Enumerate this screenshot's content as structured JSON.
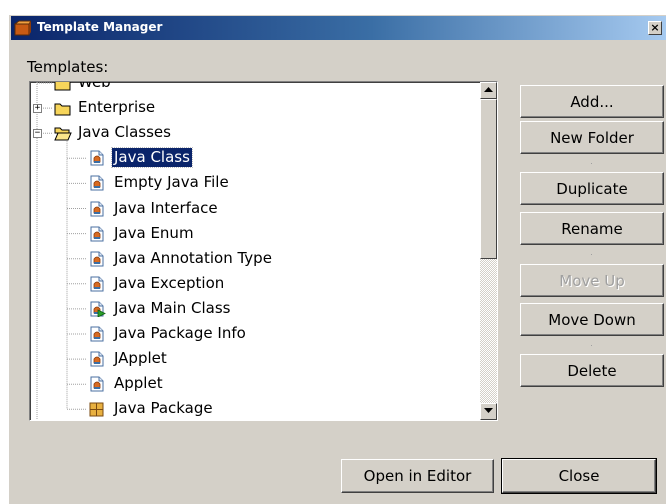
{
  "window": {
    "title": "Template Manager"
  },
  "templates_label": "Templates:",
  "tree": {
    "items": [
      {
        "label": "Web",
        "icon": "folder-icon",
        "selected": false
      },
      {
        "label": "Enterprise",
        "icon": "folder-icon",
        "expander": "+",
        "selected": false
      },
      {
        "label": "Java Classes",
        "icon": "open-folder-icon",
        "expander": "-",
        "selected": false
      },
      {
        "label": "Java Class",
        "icon": "java-file-icon",
        "selected": true
      },
      {
        "label": "Empty Java File",
        "icon": "java-file-icon",
        "selected": false
      },
      {
        "label": "Java Interface",
        "icon": "java-file-icon",
        "selected": false
      },
      {
        "label": "Java Enum",
        "icon": "java-file-icon",
        "selected": false
      },
      {
        "label": "Java Annotation Type",
        "icon": "java-file-icon",
        "selected": false
      },
      {
        "label": "Java Exception",
        "icon": "java-file-icon",
        "selected": false
      },
      {
        "label": "Java Main Class",
        "icon": "java-main-class-icon",
        "selected": false
      },
      {
        "label": "Java Package Info",
        "icon": "java-file-icon",
        "selected": false
      },
      {
        "label": "JApplet",
        "icon": "java-file-icon",
        "selected": false
      },
      {
        "label": "Applet",
        "icon": "java-file-icon",
        "selected": false
      },
      {
        "label": "Java Package",
        "icon": "package-icon",
        "selected": false
      }
    ]
  },
  "buttons": {
    "add": "Add...",
    "new_folder": "New Folder",
    "duplicate": "Duplicate",
    "rename": "Rename",
    "move_up": "Move Up",
    "move_down": "Move Down",
    "delete": "Delete",
    "open_in_editor": "Open in Editor",
    "close": "Close"
  },
  "states": {
    "move_up_enabled": false,
    "close_is_default": true
  },
  "colors": {
    "titlebar_start": "#0a246a",
    "titlebar_end": "#a6caf0",
    "selection": "#0a246a",
    "dialog_face": "#d4d0c8"
  }
}
